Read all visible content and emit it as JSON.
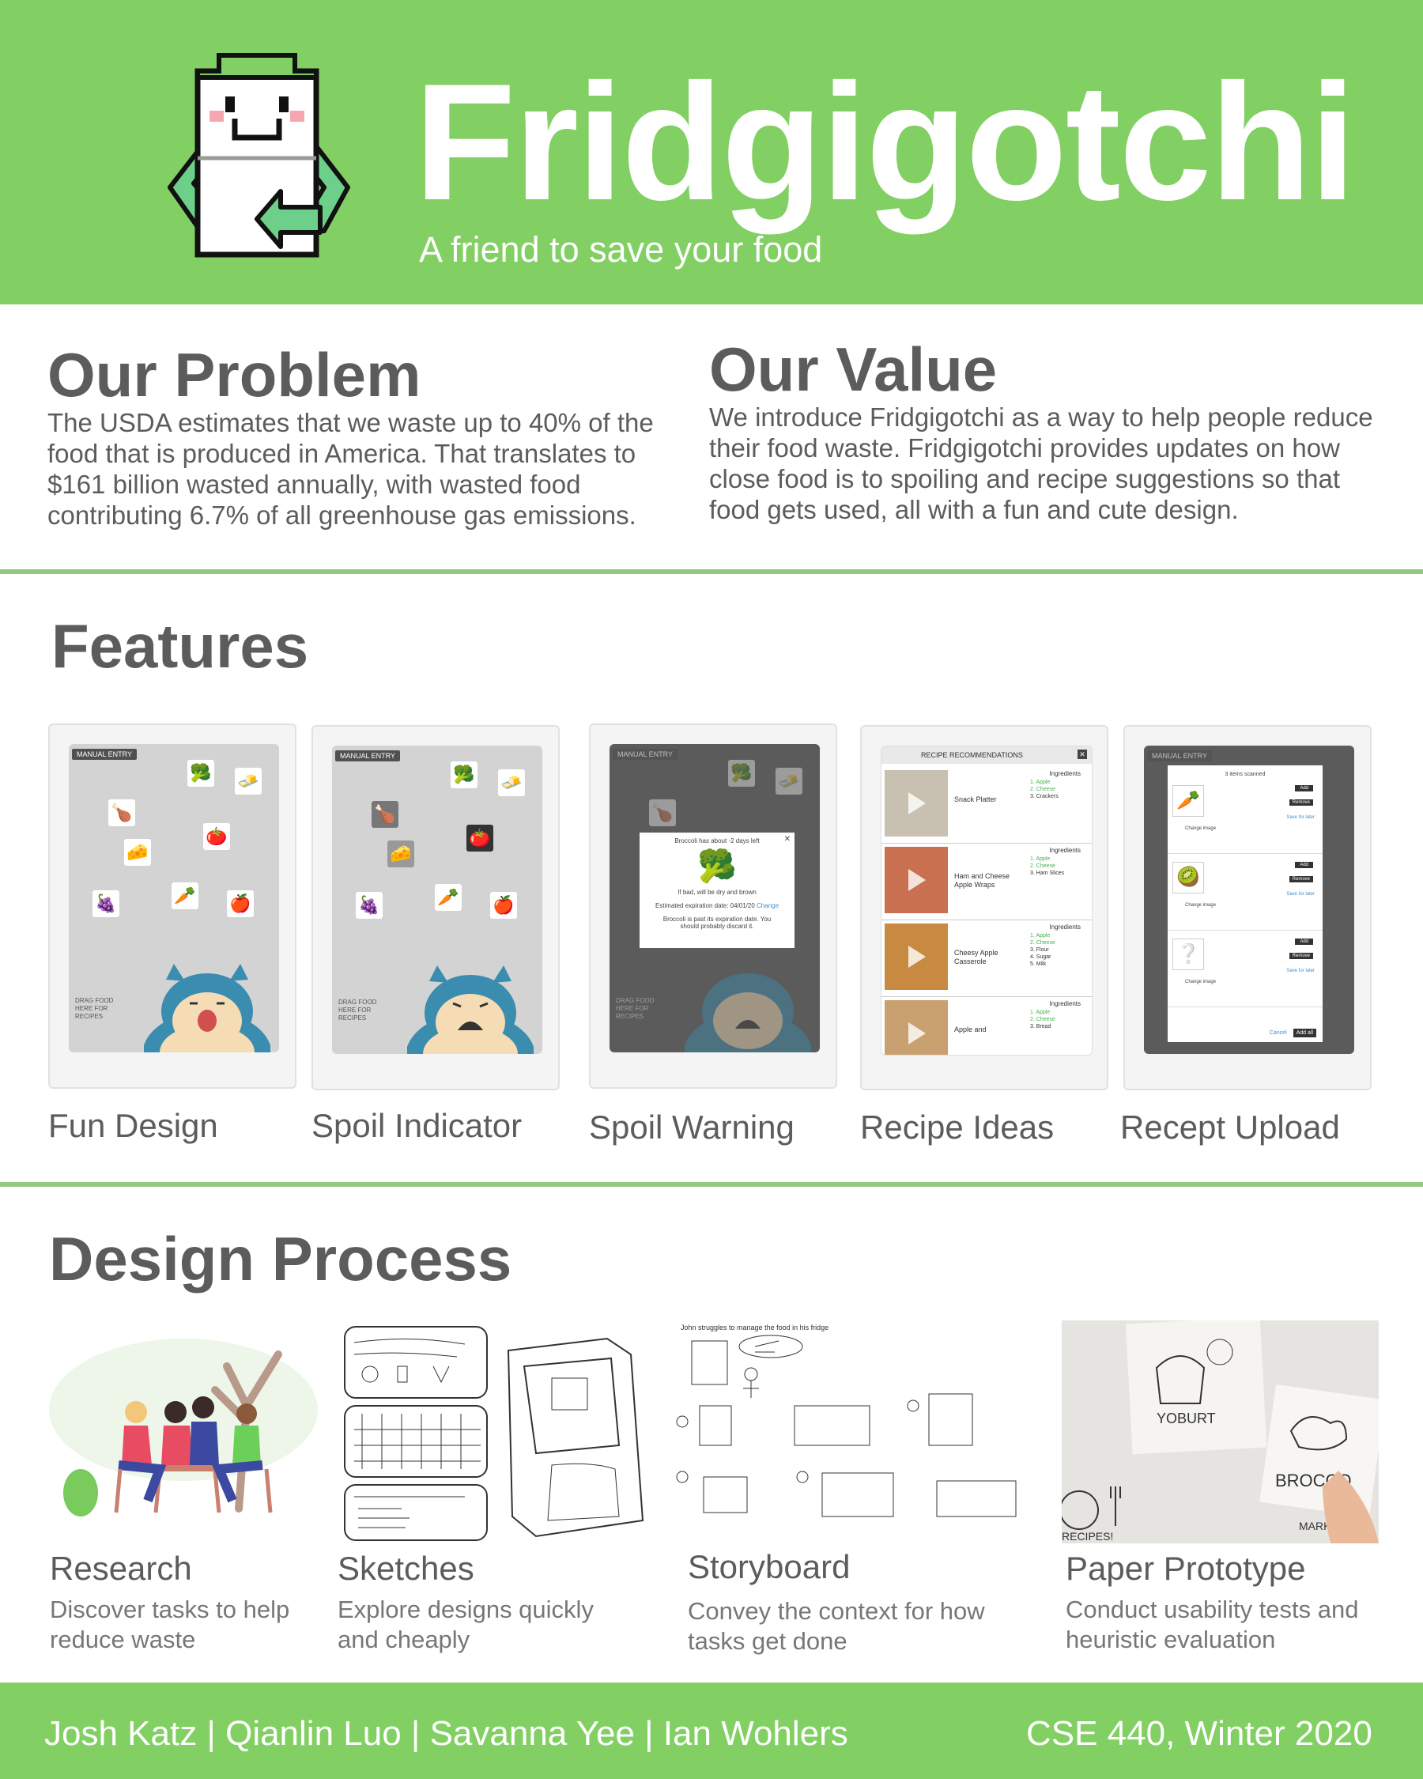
{
  "header": {
    "title": "Fridgigotchi",
    "subtitle": "A friend to save your food"
  },
  "problem": {
    "heading": "Our Problem",
    "text": "The USDA estimates that we waste up to 40% of the food that is produced in America. That translates to $161 billion wasted annually, with wasted food contributing 6.7% of all greenhouse gas emissions."
  },
  "value": {
    "heading": "Our Value",
    "text": "We introduce Fridgigotchi as a way to help people reduce their food waste. Fridgigotchi provides updates on how close food is to spoiling and recipe suggestions so that food gets used, all with a fun and cute design."
  },
  "features": {
    "heading": "Features",
    "manual_entry": "MANUAL ENTRY",
    "drag_text": "DRAG FOOD HERE FOR RECIPES",
    "items": [
      {
        "label": "Fun Design"
      },
      {
        "label": "Spoil Indicator"
      },
      {
        "label": "Spoil Warning"
      },
      {
        "label": "Recipe Ideas"
      },
      {
        "label": "Recept Upload"
      }
    ],
    "warning_dialog": {
      "title": "Broccoli has about -2 days left",
      "line1": "If bad, will be dry and brown",
      "line2": "Estimated expiration date: 04/01/20",
      "change": "Change",
      "line3": "Broccoli is past its expiration date. You should probably discard it."
    },
    "recipes": {
      "header": "RECIPE RECOMMENDATIONS",
      "ingredients_label": "Ingredients",
      "items": [
        {
          "name": "Snack Platter",
          "ingredients": [
            "1. Apple",
            "2. Cheese",
            "3. Crackers"
          ]
        },
        {
          "name": "Ham and Cheese Apple Wraps",
          "ingredients": [
            "1. Apple",
            "2. Cheese",
            "3. Ham Slices"
          ]
        },
        {
          "name": "Cheesy Apple Casserole",
          "ingredients": [
            "1. Apple",
            "2. Cheese",
            "3. Flour",
            "4. Sugar",
            "5. Milk"
          ]
        },
        {
          "name": "Apple and",
          "ingredients": [
            "1. Apple",
            "2. Cheese",
            "3. Bread"
          ]
        }
      ]
    },
    "upload": {
      "scanned": "3 items scanned",
      "add": "Add",
      "remove": "Remove",
      "save_later": "Save for later",
      "change_image": "Change image",
      "cancel": "Cancel",
      "add_all": "Add all"
    }
  },
  "process": {
    "heading": "Design Process",
    "items": [
      {
        "title": "Research",
        "desc": "Discover tasks to help reduce waste"
      },
      {
        "title": "Sketches",
        "desc": "Explore designs quickly and cheaply"
      },
      {
        "title": "Storyboard",
        "desc": "Convey the context for how tasks get done"
      },
      {
        "title": "Paper Prototype",
        "desc": "Conduct usability tests and heuristic evaluation"
      }
    ],
    "storyboard_caption": "John struggles to manage the food in his fridge",
    "prototype_labels": [
      "YOBURT",
      "BROCCO",
      "RECIPES!",
      "MARK"
    ]
  },
  "footer": {
    "names": "Josh Katz | Qianlin Luo | Savanna Yee | Ian Wohlers",
    "course": "CSE 440, Winter 2020"
  },
  "colors": {
    "brand_green": "#82cf63",
    "divider_green": "#93c981",
    "heading_gray": "#5c5c5c"
  }
}
